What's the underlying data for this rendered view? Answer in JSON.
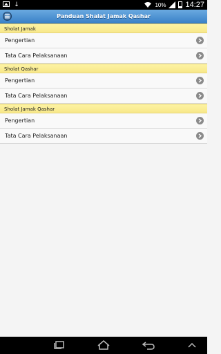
{
  "status_bar": {
    "battery": "10%",
    "time": "14:27",
    "icons": [
      "photo-icon",
      "download-icon",
      "wifi-icon",
      "signal-icon",
      "battery-icon"
    ]
  },
  "header": {
    "title": "Panduan Shalat Jamak Qashar",
    "menu_icon": "menu-icon"
  },
  "sections": [
    {
      "title": "Sholat Jamak",
      "items": [
        {
          "label": "Pengertian"
        },
        {
          "label": "Tata Cara Pelaksanaan"
        }
      ]
    },
    {
      "title": "Sholat Qashar",
      "items": [
        {
          "label": "Pengertian"
        },
        {
          "label": "Tata Cara Pelaksanaan"
        }
      ]
    },
    {
      "title": "Sholat Jamak Qashar",
      "items": [
        {
          "label": "Pengertian"
        },
        {
          "label": "Tata Cara Pelaksanaan"
        }
      ]
    }
  ],
  "nav_bar": {
    "icons": [
      "recent-apps-icon",
      "home-icon",
      "back-icon"
    ]
  },
  "colors": {
    "header": "#3b82c8",
    "divider": "#fbed95",
    "list_bg": "#f9f9f9",
    "page_bg": "#f4f4f4"
  }
}
